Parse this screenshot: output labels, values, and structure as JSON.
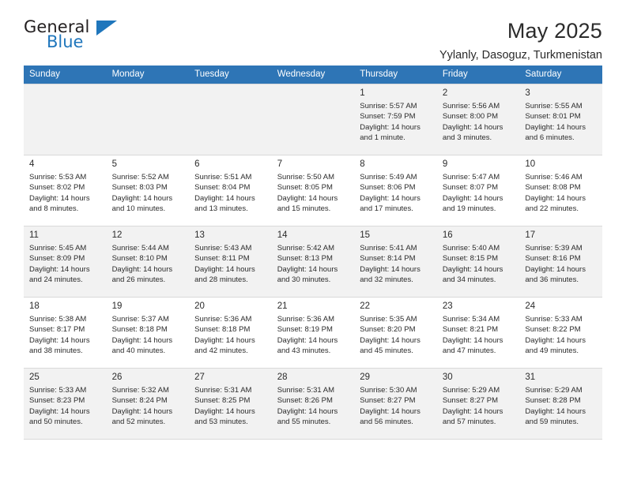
{
  "brand": {
    "name_top": "General",
    "name_bottom": "Blue",
    "accent_color": "#1f76bc"
  },
  "header": {
    "title": "May 2025",
    "subtitle": "Yylanly, Dasoguz, Turkmenistan"
  },
  "calendar": {
    "header_bg": "#2e75b6",
    "alt_row_bg": "#f2f2f2",
    "weekday_headers": [
      "Sunday",
      "Monday",
      "Tuesday",
      "Wednesday",
      "Thursday",
      "Friday",
      "Saturday"
    ],
    "weeks": [
      [
        {
          "day": "",
          "sunrise": "",
          "sunset": "",
          "daylight1": "",
          "daylight2": ""
        },
        {
          "day": "",
          "sunrise": "",
          "sunset": "",
          "daylight1": "",
          "daylight2": ""
        },
        {
          "day": "",
          "sunrise": "",
          "sunset": "",
          "daylight1": "",
          "daylight2": ""
        },
        {
          "day": "",
          "sunrise": "",
          "sunset": "",
          "daylight1": "",
          "daylight2": ""
        },
        {
          "day": "1",
          "sunrise": "Sunrise: 5:57 AM",
          "sunset": "Sunset: 7:59 PM",
          "daylight1": "Daylight: 14 hours",
          "daylight2": "and 1 minute."
        },
        {
          "day": "2",
          "sunrise": "Sunrise: 5:56 AM",
          "sunset": "Sunset: 8:00 PM",
          "daylight1": "Daylight: 14 hours",
          "daylight2": "and 3 minutes."
        },
        {
          "day": "3",
          "sunrise": "Sunrise: 5:55 AM",
          "sunset": "Sunset: 8:01 PM",
          "daylight1": "Daylight: 14 hours",
          "daylight2": "and 6 minutes."
        }
      ],
      [
        {
          "day": "4",
          "sunrise": "Sunrise: 5:53 AM",
          "sunset": "Sunset: 8:02 PM",
          "daylight1": "Daylight: 14 hours",
          "daylight2": "and 8 minutes."
        },
        {
          "day": "5",
          "sunrise": "Sunrise: 5:52 AM",
          "sunset": "Sunset: 8:03 PM",
          "daylight1": "Daylight: 14 hours",
          "daylight2": "and 10 minutes."
        },
        {
          "day": "6",
          "sunrise": "Sunrise: 5:51 AM",
          "sunset": "Sunset: 8:04 PM",
          "daylight1": "Daylight: 14 hours",
          "daylight2": "and 13 minutes."
        },
        {
          "day": "7",
          "sunrise": "Sunrise: 5:50 AM",
          "sunset": "Sunset: 8:05 PM",
          "daylight1": "Daylight: 14 hours",
          "daylight2": "and 15 minutes."
        },
        {
          "day": "8",
          "sunrise": "Sunrise: 5:49 AM",
          "sunset": "Sunset: 8:06 PM",
          "daylight1": "Daylight: 14 hours",
          "daylight2": "and 17 minutes."
        },
        {
          "day": "9",
          "sunrise": "Sunrise: 5:47 AM",
          "sunset": "Sunset: 8:07 PM",
          "daylight1": "Daylight: 14 hours",
          "daylight2": "and 19 minutes."
        },
        {
          "day": "10",
          "sunrise": "Sunrise: 5:46 AM",
          "sunset": "Sunset: 8:08 PM",
          "daylight1": "Daylight: 14 hours",
          "daylight2": "and 22 minutes."
        }
      ],
      [
        {
          "day": "11",
          "sunrise": "Sunrise: 5:45 AM",
          "sunset": "Sunset: 8:09 PM",
          "daylight1": "Daylight: 14 hours",
          "daylight2": "and 24 minutes."
        },
        {
          "day": "12",
          "sunrise": "Sunrise: 5:44 AM",
          "sunset": "Sunset: 8:10 PM",
          "daylight1": "Daylight: 14 hours",
          "daylight2": "and 26 minutes."
        },
        {
          "day": "13",
          "sunrise": "Sunrise: 5:43 AM",
          "sunset": "Sunset: 8:11 PM",
          "daylight1": "Daylight: 14 hours",
          "daylight2": "and 28 minutes."
        },
        {
          "day": "14",
          "sunrise": "Sunrise: 5:42 AM",
          "sunset": "Sunset: 8:13 PM",
          "daylight1": "Daylight: 14 hours",
          "daylight2": "and 30 minutes."
        },
        {
          "day": "15",
          "sunrise": "Sunrise: 5:41 AM",
          "sunset": "Sunset: 8:14 PM",
          "daylight1": "Daylight: 14 hours",
          "daylight2": "and 32 minutes."
        },
        {
          "day": "16",
          "sunrise": "Sunrise: 5:40 AM",
          "sunset": "Sunset: 8:15 PM",
          "daylight1": "Daylight: 14 hours",
          "daylight2": "and 34 minutes."
        },
        {
          "day": "17",
          "sunrise": "Sunrise: 5:39 AM",
          "sunset": "Sunset: 8:16 PM",
          "daylight1": "Daylight: 14 hours",
          "daylight2": "and 36 minutes."
        }
      ],
      [
        {
          "day": "18",
          "sunrise": "Sunrise: 5:38 AM",
          "sunset": "Sunset: 8:17 PM",
          "daylight1": "Daylight: 14 hours",
          "daylight2": "and 38 minutes."
        },
        {
          "day": "19",
          "sunrise": "Sunrise: 5:37 AM",
          "sunset": "Sunset: 8:18 PM",
          "daylight1": "Daylight: 14 hours",
          "daylight2": "and 40 minutes."
        },
        {
          "day": "20",
          "sunrise": "Sunrise: 5:36 AM",
          "sunset": "Sunset: 8:18 PM",
          "daylight1": "Daylight: 14 hours",
          "daylight2": "and 42 minutes."
        },
        {
          "day": "21",
          "sunrise": "Sunrise: 5:36 AM",
          "sunset": "Sunset: 8:19 PM",
          "daylight1": "Daylight: 14 hours",
          "daylight2": "and 43 minutes."
        },
        {
          "day": "22",
          "sunrise": "Sunrise: 5:35 AM",
          "sunset": "Sunset: 8:20 PM",
          "daylight1": "Daylight: 14 hours",
          "daylight2": "and 45 minutes."
        },
        {
          "day": "23",
          "sunrise": "Sunrise: 5:34 AM",
          "sunset": "Sunset: 8:21 PM",
          "daylight1": "Daylight: 14 hours",
          "daylight2": "and 47 minutes."
        },
        {
          "day": "24",
          "sunrise": "Sunrise: 5:33 AM",
          "sunset": "Sunset: 8:22 PM",
          "daylight1": "Daylight: 14 hours",
          "daylight2": "and 49 minutes."
        }
      ],
      [
        {
          "day": "25",
          "sunrise": "Sunrise: 5:33 AM",
          "sunset": "Sunset: 8:23 PM",
          "daylight1": "Daylight: 14 hours",
          "daylight2": "and 50 minutes."
        },
        {
          "day": "26",
          "sunrise": "Sunrise: 5:32 AM",
          "sunset": "Sunset: 8:24 PM",
          "daylight1": "Daylight: 14 hours",
          "daylight2": "and 52 minutes."
        },
        {
          "day": "27",
          "sunrise": "Sunrise: 5:31 AM",
          "sunset": "Sunset: 8:25 PM",
          "daylight1": "Daylight: 14 hours",
          "daylight2": "and 53 minutes."
        },
        {
          "day": "28",
          "sunrise": "Sunrise: 5:31 AM",
          "sunset": "Sunset: 8:26 PM",
          "daylight1": "Daylight: 14 hours",
          "daylight2": "and 55 minutes."
        },
        {
          "day": "29",
          "sunrise": "Sunrise: 5:30 AM",
          "sunset": "Sunset: 8:27 PM",
          "daylight1": "Daylight: 14 hours",
          "daylight2": "and 56 minutes."
        },
        {
          "day": "30",
          "sunrise": "Sunrise: 5:29 AM",
          "sunset": "Sunset: 8:27 PM",
          "daylight1": "Daylight: 14 hours",
          "daylight2": "and 57 minutes."
        },
        {
          "day": "31",
          "sunrise": "Sunrise: 5:29 AM",
          "sunset": "Sunset: 8:28 PM",
          "daylight1": "Daylight: 14 hours",
          "daylight2": "and 59 minutes."
        }
      ]
    ]
  }
}
